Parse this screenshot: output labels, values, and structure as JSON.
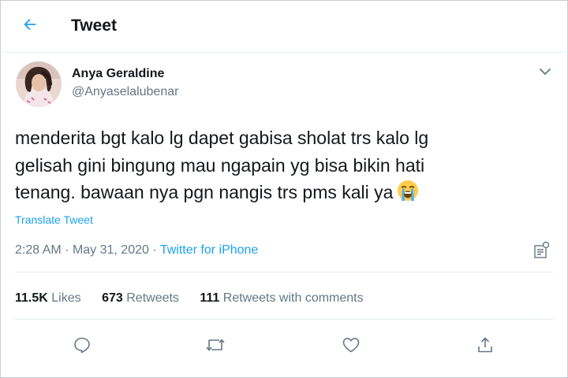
{
  "header": {
    "title": "Tweet",
    "back_icon": "arrow-left-icon"
  },
  "author": {
    "name": "Anya Geraldine",
    "handle": "@Anyaselalubenar"
  },
  "tweet": {
    "line1": "menderita bgt kalo lg dapet gabisa sholat trs kalo lg",
    "line2": "gelisah gini bingung mau ngapain yg bisa bikin hati",
    "line3": "tenang. bawaan nya pgn nangis trs pms kali ya",
    "emoji_icon": "loudly-crying-face-icon",
    "translate_label": "Translate Tweet"
  },
  "meta": {
    "time": "2:28 AM",
    "separator": "·",
    "date": "May 31, 2020",
    "source": "Twitter for iPhone"
  },
  "stats": {
    "likes_count": "11.5K",
    "likes_label": "Likes",
    "retweets_count": "673",
    "retweets_label": "Retweets",
    "comments_count": "111",
    "comments_label": "Retweets with comments"
  },
  "colors": {
    "accent": "#1da1f2",
    "secondary_text": "#657786",
    "primary_text": "#14171a",
    "divider": "#e6ecf0"
  }
}
